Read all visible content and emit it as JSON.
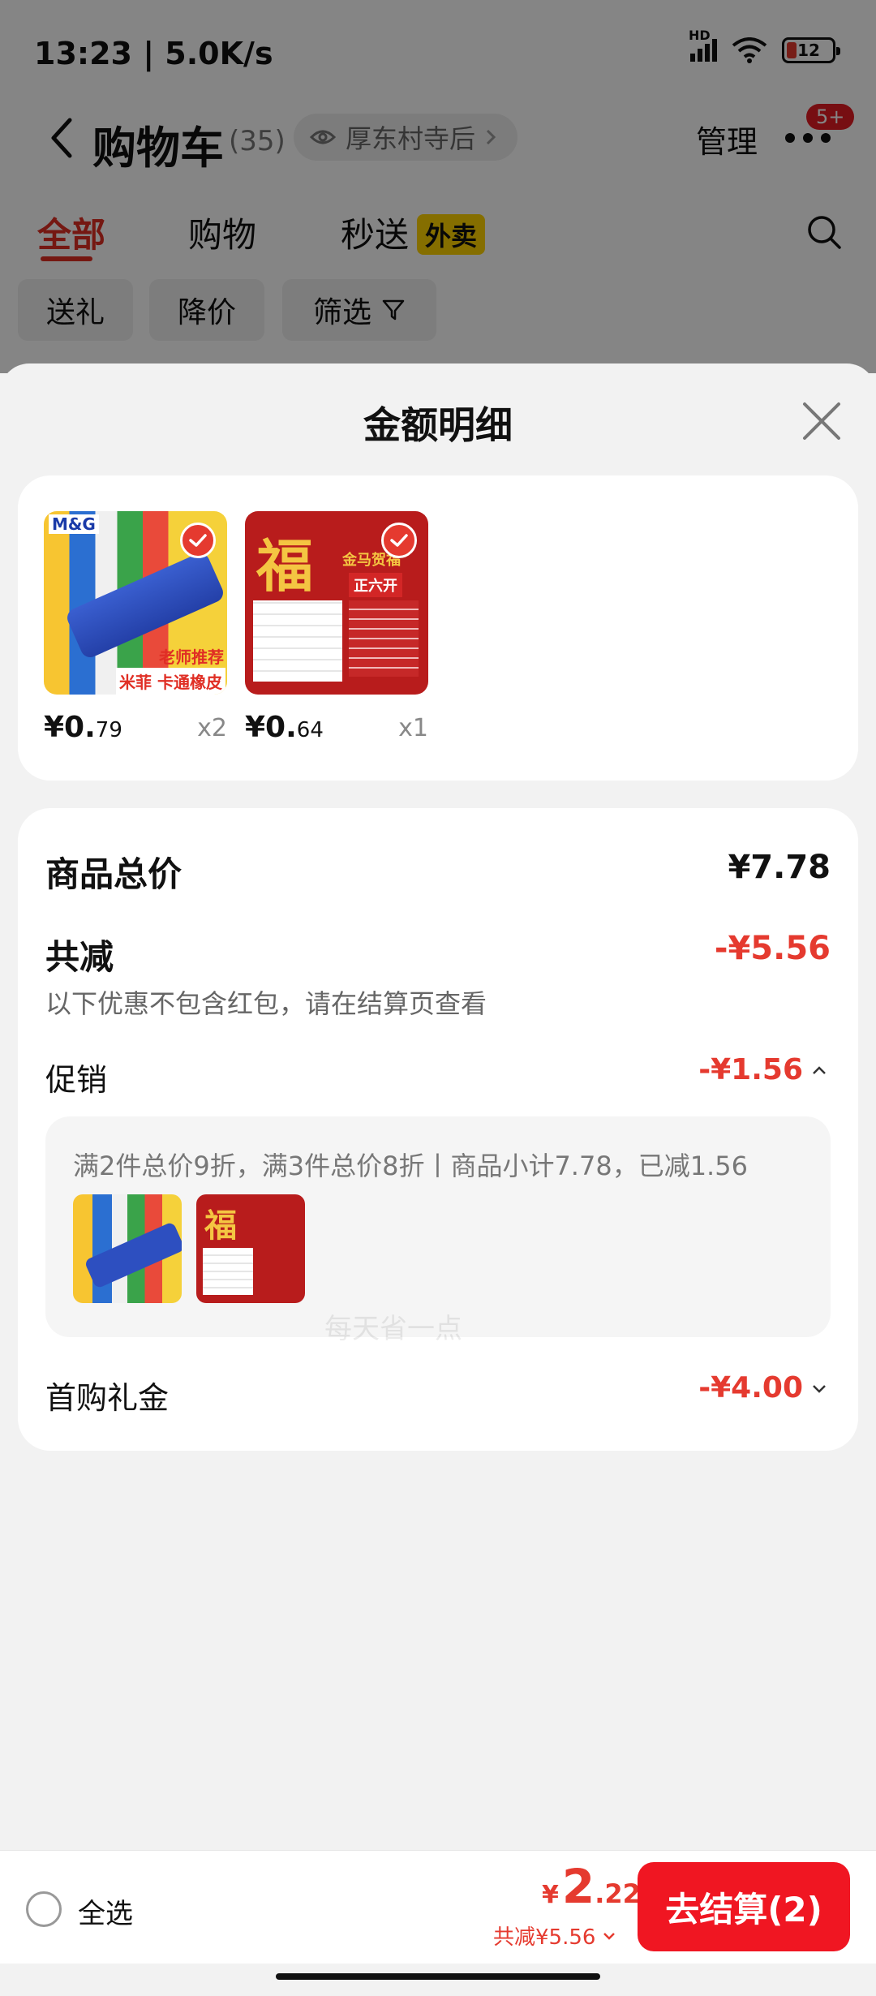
{
  "status_bar": {
    "time": "13:23 | 5.0K/s",
    "hd_label": "HD",
    "battery": "12"
  },
  "nav": {
    "title": "购物车",
    "count": "(35)",
    "location": "厚东村寺后",
    "manage": "管理",
    "badge": "5+"
  },
  "tabs": [
    {
      "label": "全部",
      "active": true
    },
    {
      "label": "购物",
      "active": false
    },
    {
      "label": "秒送",
      "active": false
    }
  ],
  "tab_tag": "外卖",
  "filters": [
    "送礼",
    "降价",
    "筛选"
  ],
  "sheet": {
    "title": "金额明细",
    "items": [
      {
        "price_main": "¥0.",
        "price_dec": "79",
        "qty": "x2",
        "image_text_1": "老师推荐",
        "image_text_2": "米菲 卡通橡皮",
        "brand": "M&G"
      },
      {
        "price_main": "¥0.",
        "price_dec": "64",
        "qty": "x1",
        "image_text_1": "金马贺福",
        "image_text_2": "正六开",
        "glyph": "福"
      }
    ],
    "total_label": "商品总价",
    "total_value": "¥7.78",
    "discount_label": "共减",
    "discount_value": "-¥5.56",
    "discount_note": "以下优惠不包含红包，请在结算页查看",
    "promo_label": "促销",
    "promo_value": "-¥1.56",
    "promo_desc": "满2件总价9折，满3件总价8折丨商品小计7.78，已减1.56",
    "gift_label": "首购礼金",
    "gift_value": "-¥4.00",
    "watermark": "每天省一点"
  },
  "bottom": {
    "select_all": "全选",
    "total_currency": "¥",
    "total_int": "2",
    "total_dec": ".22",
    "reduced": "共减¥5.56",
    "checkout": "去结算(2)"
  },
  "colors": {
    "accent": "#e53a2f",
    "checkout": "#f01622",
    "tag_yellow": "#ffd400"
  },
  "icons": [
    "back-arrow-icon",
    "eye-icon",
    "chevron-right-icon",
    "more-dots-icon",
    "search-icon",
    "filter-funnel-icon",
    "close-icon",
    "check-icon",
    "chevron-up-icon",
    "chevron-down-icon"
  ]
}
